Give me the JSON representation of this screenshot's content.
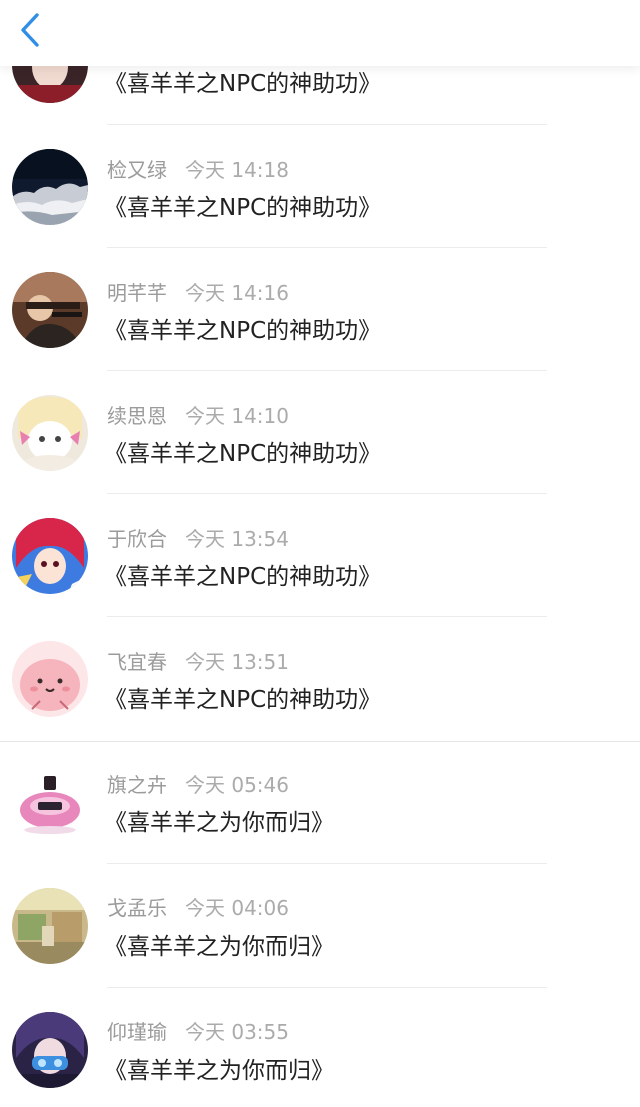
{
  "header": {
    "back_icon": "chevron-left-icon",
    "accent": "#2f8fe6"
  },
  "items": [
    {
      "name": "",
      "time": "",
      "title": "《喜羊羊之NPC的神助功》",
      "avatar": "avatar-girl-dark"
    },
    {
      "name": "检又绿",
      "time": "今天 14:18",
      "title": "《喜羊羊之NPC的神助功》",
      "avatar": "avatar-night-sky"
    },
    {
      "name": "明芊芊",
      "time": "今天 14:16",
      "title": "《喜羊羊之NPC的神助功》",
      "avatar": "avatar-gunner"
    },
    {
      "name": "续思恩",
      "time": "今天 14:10",
      "title": "《喜羊羊之NPC的神助功》",
      "avatar": "avatar-cat"
    },
    {
      "name": "于欣合",
      "time": "今天 13:54",
      "title": "《喜羊羊之NPC的神助功》",
      "avatar": "avatar-anime-red"
    },
    {
      "name": "飞宜春",
      "time": "今天 13:51",
      "title": "《喜羊羊之NPC的神助功》",
      "avatar": "avatar-pink-blob"
    },
    {
      "name": "旗之卉",
      "time": "今天 05:46",
      "title": "《喜羊羊之为你而归》",
      "avatar": "avatar-perfume"
    },
    {
      "name": "戈孟乐",
      "time": "今天 04:06",
      "title": "《喜羊羊之为你而归》",
      "avatar": "avatar-room"
    },
    {
      "name": "仰瑾瑜",
      "time": "今天 03:55",
      "title": "《喜羊羊之为你而归》",
      "avatar": "avatar-masked"
    }
  ]
}
